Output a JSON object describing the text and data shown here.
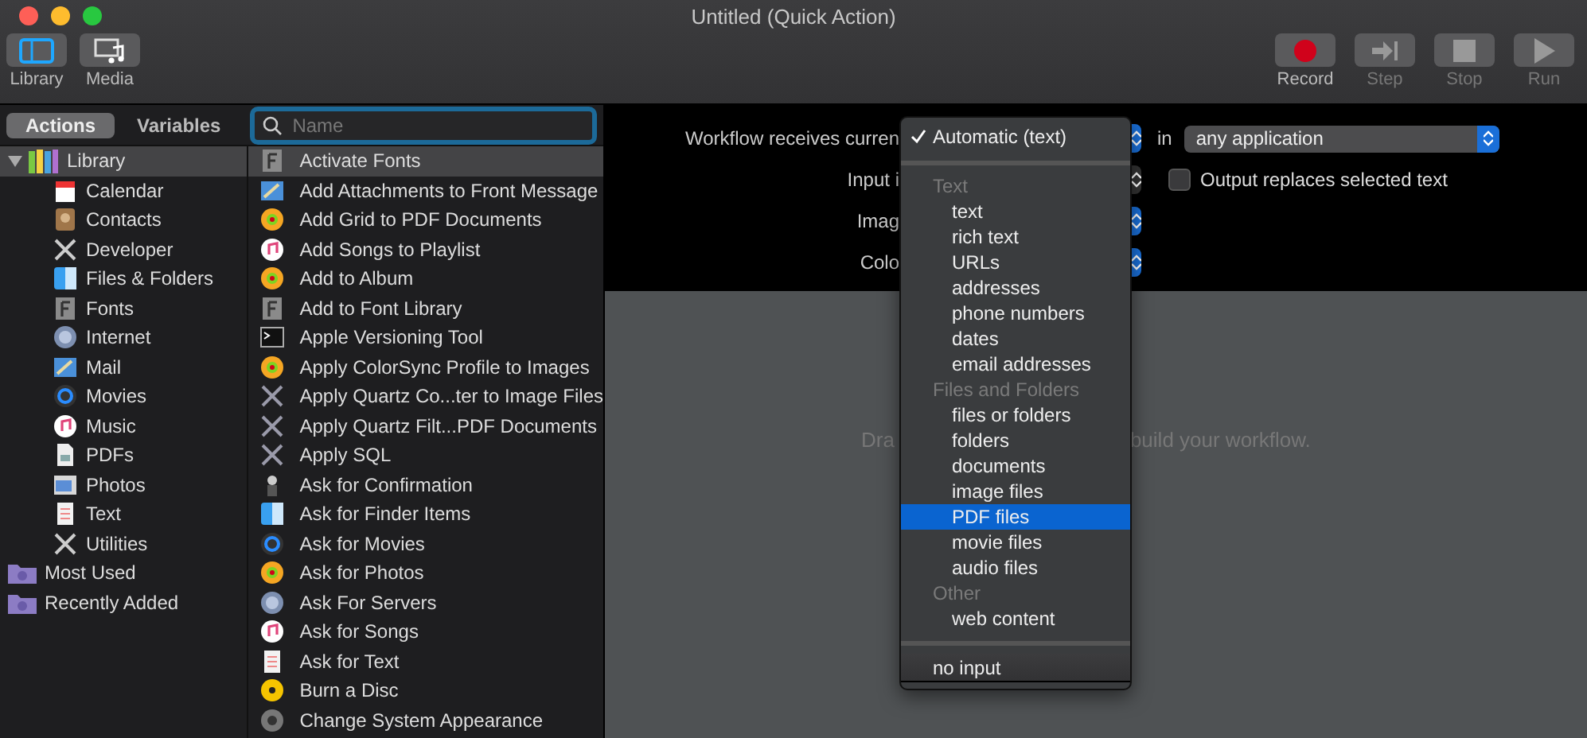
{
  "window": {
    "title": "Untitled (Quick Action)"
  },
  "toolbar": {
    "left": [
      {
        "label": "Library",
        "selected": true
      },
      {
        "label": "Media",
        "selected": false
      }
    ],
    "right": [
      {
        "label": "Record",
        "disabled": false
      },
      {
        "label": "Step",
        "disabled": true
      },
      {
        "label": "Stop",
        "disabled": true
      },
      {
        "label": "Run",
        "disabled": true
      }
    ]
  },
  "library_tabs": [
    {
      "label": "Actions",
      "selected": true
    },
    {
      "label": "Variables",
      "selected": false
    }
  ],
  "search": {
    "placeholder": "Name"
  },
  "categories": [
    {
      "label": "Library",
      "expanded": true,
      "selected": true,
      "children": [
        {
          "label": "Calendar"
        },
        {
          "label": "Contacts"
        },
        {
          "label": "Developer"
        },
        {
          "label": "Files & Folders"
        },
        {
          "label": "Fonts"
        },
        {
          "label": "Internet"
        },
        {
          "label": "Mail"
        },
        {
          "label": "Movies"
        },
        {
          "label": "Music"
        },
        {
          "label": "PDFs"
        },
        {
          "label": "Photos"
        },
        {
          "label": "Text"
        },
        {
          "label": "Utilities"
        }
      ]
    },
    {
      "label": "Most Used",
      "selected": false
    },
    {
      "label": "Recently Added",
      "selected": false
    }
  ],
  "actions": [
    {
      "label": "Activate Fonts",
      "selected": true
    },
    {
      "label": "Add Attachments to Front Message",
      "selected": false
    },
    {
      "label": "Add Grid to PDF Documents",
      "selected": false
    },
    {
      "label": "Add Songs to Playlist",
      "selected": false
    },
    {
      "label": "Add to Album",
      "selected": false
    },
    {
      "label": "Add to Font Library",
      "selected": false
    },
    {
      "label": "Apple Versioning Tool",
      "selected": false
    },
    {
      "label": "Apply ColorSync Profile to Images",
      "selected": false
    },
    {
      "label": "Apply Quartz Co...ter to Image Files",
      "selected": false
    },
    {
      "label": "Apply Quartz Filt...PDF Documents",
      "selected": false
    },
    {
      "label": "Apply SQL",
      "selected": false
    },
    {
      "label": "Ask for Confirmation",
      "selected": false
    },
    {
      "label": "Ask for Finder Items",
      "selected": false
    },
    {
      "label": "Ask for Movies",
      "selected": false
    },
    {
      "label": "Ask for Photos",
      "selected": false
    },
    {
      "label": "Ask For Servers",
      "selected": false
    },
    {
      "label": "Ask for Songs",
      "selected": false
    },
    {
      "label": "Ask for Text",
      "selected": false
    },
    {
      "label": "Burn a Disc",
      "selected": false
    },
    {
      "label": "Change System Appearance",
      "selected": false
    }
  ],
  "settings": [
    {
      "label": "Workflow receives curren",
      "extra": "in",
      "popup": "any application"
    },
    {
      "label": "Input i",
      "checkbox": {
        "label": "Output replaces selected text",
        "checked": false
      }
    },
    {
      "label": "Imag"
    },
    {
      "label": "Colo"
    }
  ],
  "canvas_hint": [
    "Dra",
    "build your workflow."
  ],
  "menu": [
    {
      "kind": "item",
      "label": "Automatic (text)",
      "checked": true,
      "selected": false
    },
    {
      "kind": "separator"
    },
    {
      "kind": "header",
      "label": "Text"
    },
    {
      "kind": "item",
      "label": "text",
      "checked": false,
      "selected": false
    },
    {
      "kind": "item",
      "label": "rich text",
      "checked": false,
      "selected": false
    },
    {
      "kind": "item",
      "label": "URLs",
      "checked": false,
      "selected": false
    },
    {
      "kind": "item",
      "label": "addresses",
      "checked": false,
      "selected": false
    },
    {
      "kind": "item",
      "label": "phone numbers",
      "checked": false,
      "selected": false
    },
    {
      "kind": "item",
      "label": "dates",
      "checked": false,
      "selected": false
    },
    {
      "kind": "item",
      "label": "email addresses",
      "checked": false,
      "selected": false
    },
    {
      "kind": "header",
      "label": "Files and Folders"
    },
    {
      "kind": "item",
      "label": "files or folders",
      "checked": false,
      "selected": false
    },
    {
      "kind": "item",
      "label": "folders",
      "checked": false,
      "selected": false
    },
    {
      "kind": "item",
      "label": "documents",
      "checked": false,
      "selected": false
    },
    {
      "kind": "item",
      "label": "image files",
      "checked": false,
      "selected": false
    },
    {
      "kind": "item",
      "label": "PDF files",
      "checked": false,
      "selected": true
    },
    {
      "kind": "item",
      "label": "movie files",
      "checked": false,
      "selected": false
    },
    {
      "kind": "item",
      "label": "audio files",
      "checked": false,
      "selected": false
    },
    {
      "kind": "header",
      "label": "Other"
    },
    {
      "kind": "item",
      "label": "web content",
      "checked": false,
      "selected": false
    },
    {
      "kind": "separator"
    },
    {
      "kind": "top",
      "label": "no input",
      "checked": false,
      "selected": false
    }
  ]
}
